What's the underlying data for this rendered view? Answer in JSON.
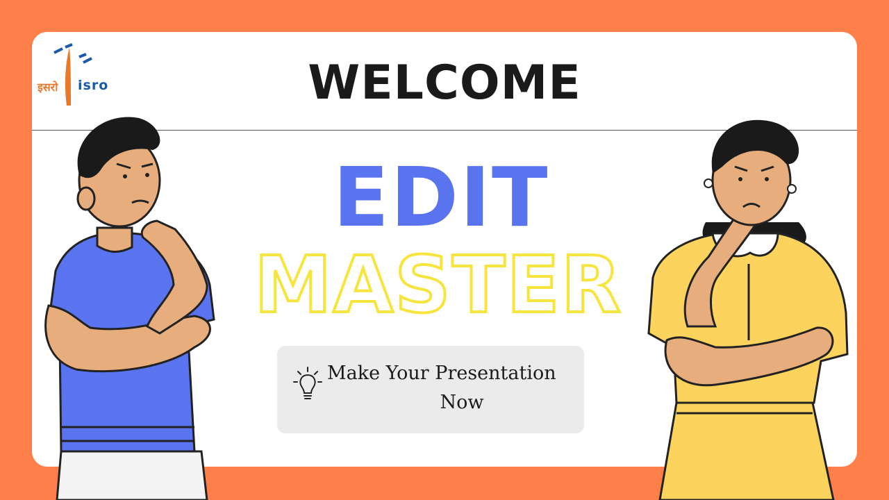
{
  "logo": {
    "hindi": "इसरो",
    "english": "isro"
  },
  "heading": "WELCOME",
  "title": {
    "line1": "EDIT",
    "line2": "MASTER"
  },
  "cta": {
    "line1": "Make Your Presentation",
    "line2": "Now",
    "icon": "lightbulb-icon"
  },
  "colors": {
    "background": "#ff7f4a",
    "edit": "#5a73ee",
    "master_outline": "#f6e53e",
    "boy_shirt": "#5a73ee",
    "girl_dress": "#fcd35c",
    "skin": "#e8ad7c"
  }
}
